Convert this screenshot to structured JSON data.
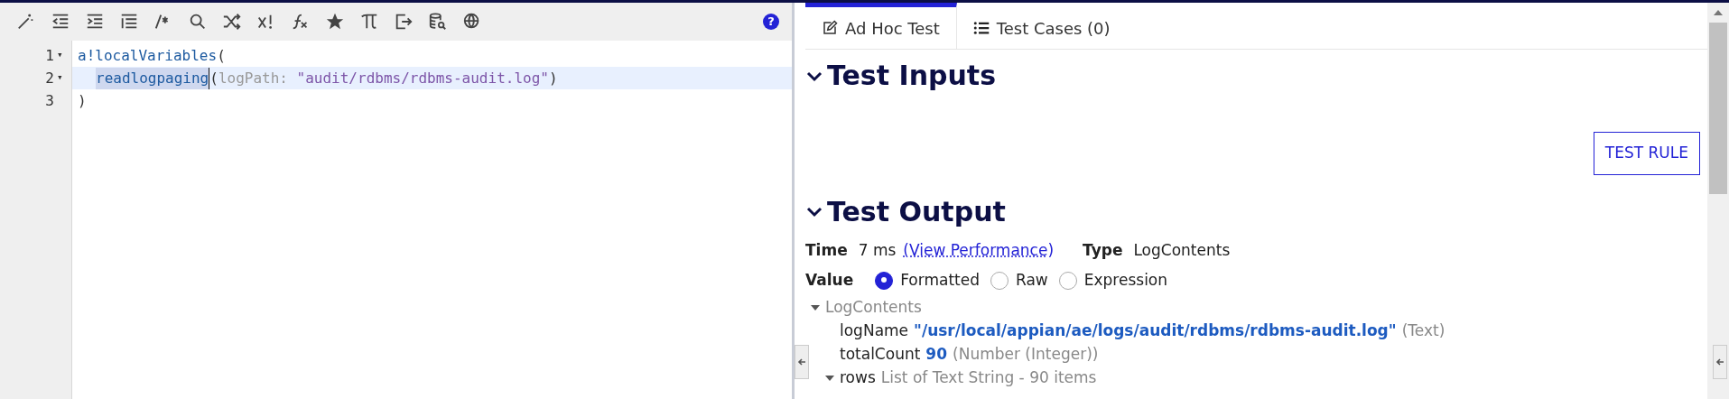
{
  "toolbar": {
    "help": "?"
  },
  "editor": {
    "lines": [
      {
        "number": "1",
        "fold": "▾",
        "highlighted": false,
        "indented": false,
        "tokens": [
          {
            "kind": "function",
            "text": "a!localVariables"
          },
          {
            "kind": "punct",
            "text": "("
          }
        ]
      },
      {
        "number": "2",
        "fold": "▾",
        "highlighted": true,
        "indented": true,
        "tokens": [
          {
            "kind": "selected",
            "text": "readlogpaging"
          },
          {
            "kind": "punct",
            "text": "("
          },
          {
            "kind": "hint",
            "text": "logPath:"
          },
          {
            "kind": "string",
            "text": "\"audit/rdbms/rdbms-audit.log\""
          },
          {
            "kind": "punct",
            "text": ")"
          }
        ]
      },
      {
        "number": "3",
        "highlighted": false,
        "indented": false,
        "tokens": [
          {
            "kind": "punct",
            "text": ")"
          }
        ]
      }
    ]
  },
  "tabs": [
    {
      "label": "Ad Hoc Test",
      "selected": true
    },
    {
      "label": "Test Cases (0)",
      "selected": false
    }
  ],
  "test_inputs": {
    "title": "Test Inputs",
    "expanded": true,
    "button": "TEST RULE"
  },
  "test_output": {
    "title": "Test Output",
    "expanded": true,
    "time_label": "Time",
    "time_value": "7 ms",
    "performance_link": "(View Performance)",
    "type_label": "Type",
    "type_value": "LogContents",
    "value_label": "Value",
    "value_options": [
      {
        "label": "Formatted",
        "selected": true
      },
      {
        "label": "Raw",
        "selected": false
      },
      {
        "label": "Expression",
        "selected": false
      }
    ],
    "tree": {
      "label": "LogContents",
      "expanded": true,
      "children": [
        {
          "name": "logName",
          "value": "\"/usr/local/appian/ae/logs/audit/rdbms/rdbms-audit.log\"",
          "type": "(Text)"
        },
        {
          "name": "totalCount",
          "value": "90",
          "type": "(Number (Integer))"
        },
        {
          "name": "rows",
          "expanded": true,
          "type": "List of Text String - 90 items"
        }
      ]
    }
  }
}
